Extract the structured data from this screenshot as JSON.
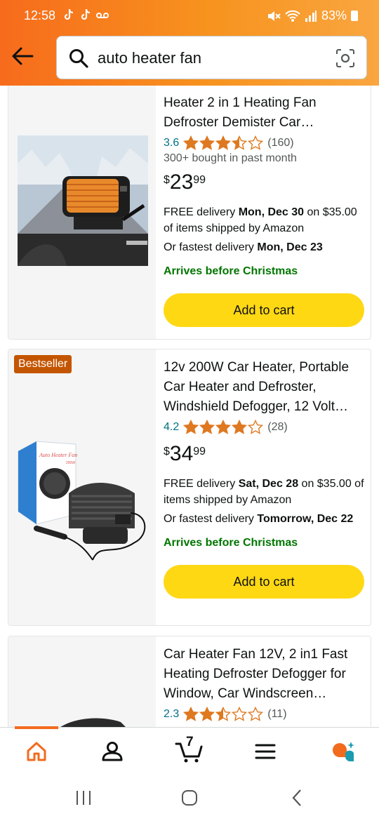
{
  "status_bar": {
    "time": "12:58",
    "battery": "83%"
  },
  "search": {
    "query": "auto heater fan"
  },
  "products": [
    {
      "title": "Heater 2 in 1 Heating Fan Defroster Demister Car…",
      "rating": "3.6",
      "rating_value": 3.6,
      "review_count": "(160)",
      "bought": "300+ bought in past month",
      "price_symbol": "$",
      "price_whole": "23",
      "price_fraction": "99",
      "delivery_prefix": "FREE delivery ",
      "delivery_date": "Mon, Dec 30",
      "delivery_suffix": " on $35.00 of items shipped by Amazon",
      "fastest_prefix": "Or fastest delivery ",
      "fastest_date": "Mon, Dec 23",
      "arrives": "Arrives before Christmas",
      "cart_label": "Add to cart"
    },
    {
      "badge": "Bestseller",
      "title": "12v 200W Car Heater, Portable Car Heater and Defroster, Windshield Defogger, 12 Volt…",
      "rating": "4.2",
      "rating_value": 4.2,
      "review_count": "(28)",
      "price_symbol": "$",
      "price_whole": "34",
      "price_fraction": "99",
      "delivery_prefix": "FREE delivery ",
      "delivery_date": "Sat, Dec 28",
      "delivery_suffix": " on $35.00 of items shipped by Amazon",
      "fastest_prefix": "Or fastest delivery ",
      "fastest_date": "Tomorrow, Dec 22",
      "arrives": "Arrives before Christmas",
      "cart_label": "Add to cart",
      "box_text": "Auto Heater Fan",
      "box_wattage": "200W"
    },
    {
      "title": "Car Heater Fan 12V, 2 in1 Fast Heating Defroster Defogger for Window, Car Windscreen…",
      "rating": "2.3",
      "rating_value": 2.3,
      "review_count": "(11)"
    }
  ],
  "bottom_nav": {
    "cart_count": "7",
    "items": [
      "home-icon",
      "account-icon",
      "cart-icon",
      "menu-icon",
      "rufus-icon"
    ]
  },
  "colors": {
    "header_orange": "#f7931e",
    "star": "#de7921",
    "button_yellow": "#ffd814",
    "link_teal": "#007185",
    "arrives_green": "#007600",
    "badge": "#c45500"
  }
}
